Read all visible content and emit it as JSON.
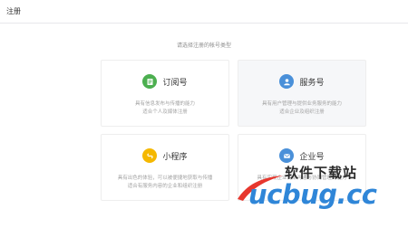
{
  "topbar": {
    "title": "注册"
  },
  "subtitle": "请选择注册的帐号类型",
  "cards": [
    {
      "name": "订阅号",
      "desc_line1": "具有信息发布与传播的能力",
      "desc_line2": "适合个人及媒体注册",
      "icon": "document-icon",
      "color": "#4caf50"
    },
    {
      "name": "服务号",
      "desc_line1": "具有用户管理与提供业务服务的能力",
      "desc_line2": "适合企业及组织注册",
      "icon": "user-icon",
      "color": "#4a90d9"
    },
    {
      "name": "小程序",
      "desc_line1": "具有出色的体验，可以被便捷地获取与传播",
      "desc_line2": "适合有服务内容的企业和组织注册",
      "icon": "miniprogram-icon",
      "color": "#f5b800"
    },
    {
      "name": "企业号",
      "desc_line1": "具有实现企业内部沟通与协同管理的能力",
      "desc_line2": "",
      "icon": "mail-icon",
      "color": "#4a90d9"
    }
  ],
  "watermark": {
    "cn": "软件下载站",
    "en": "ucbug.cc"
  }
}
